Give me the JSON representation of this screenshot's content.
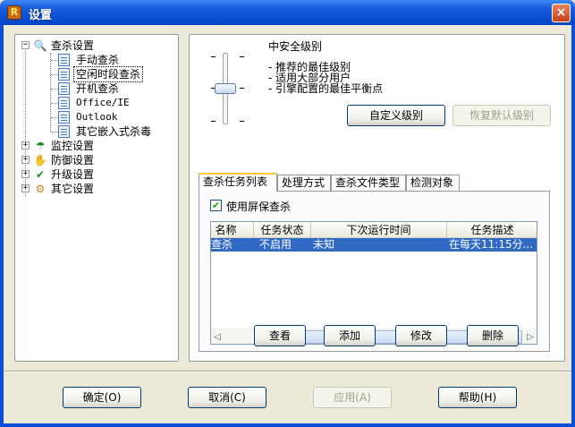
{
  "window": {
    "title": "设置",
    "close_glyph": "×",
    "app_icon": "rising-lion-icon"
  },
  "tree": {
    "root": "查杀设置",
    "children": [
      "手动查杀",
      "空闲时段查杀",
      "开机查杀",
      "Office/IE",
      "Outlook",
      "其它嵌入式杀毒"
    ],
    "selected": "空闲时段查杀",
    "others": [
      "监控设置",
      "防御设置",
      "升级设置",
      "其它设置"
    ]
  },
  "level": {
    "title": "中安全级别",
    "bullets": [
      "- 推荐的最佳级别",
      "- 适用大部分用户",
      "- 引擎配置的最佳平衡点"
    ],
    "custom_button": "自定义级别",
    "restore_button": "恢复默认级别",
    "slider_position": "2 of 3"
  },
  "tabs": [
    "查杀任务列表",
    "处理方式",
    "查杀文件类型",
    "检测对象"
  ],
  "active_tab": "查杀任务列表",
  "screensaver": {
    "checked": true,
    "label": "使用屏保查杀"
  },
  "task_table": {
    "columns": [
      "名称",
      "任务状态",
      "下次运行时间",
      "任务描述"
    ],
    "rows": [
      [
        "屏保查杀",
        "不启用",
        "未知",
        "在每天11:15分..."
      ]
    ]
  },
  "task_buttons": {
    "view": "查看",
    "add": "添加",
    "edit": "修改",
    "delete": "删除"
  },
  "footer": {
    "ok": "确定(O)",
    "cancel": "取消(C)",
    "apply": "应用(A)",
    "help": "帮助(H)"
  },
  "colors": {
    "titlebar": "#0a4fd4",
    "selection": "#316ac5",
    "dialog_bg": "#ece9d8"
  }
}
